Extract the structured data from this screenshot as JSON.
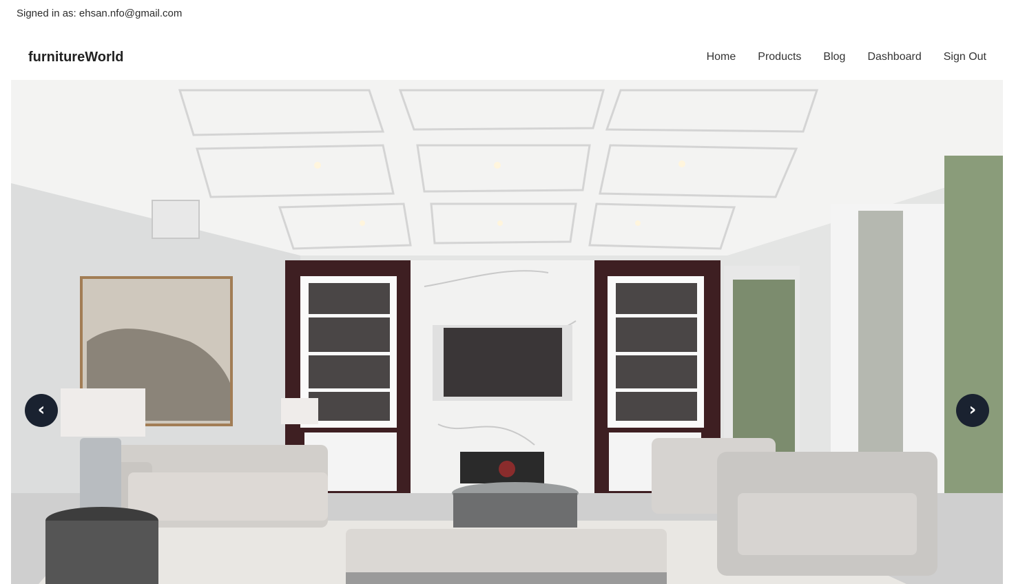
{
  "signed_in": "Signed in as: ehsan.nfo@gmail.com",
  "brand": "furnitureWorld",
  "nav": {
    "home": "Home",
    "products": "Products",
    "blog": "Blog",
    "dashboard": "Dashboard",
    "signout": "Sign Out"
  },
  "carousel": {
    "prev_glyph": "‹",
    "next_glyph": "›"
  },
  "colors": {
    "control_bg": "#1a2230",
    "shelf_wood": "#3e1f22"
  }
}
